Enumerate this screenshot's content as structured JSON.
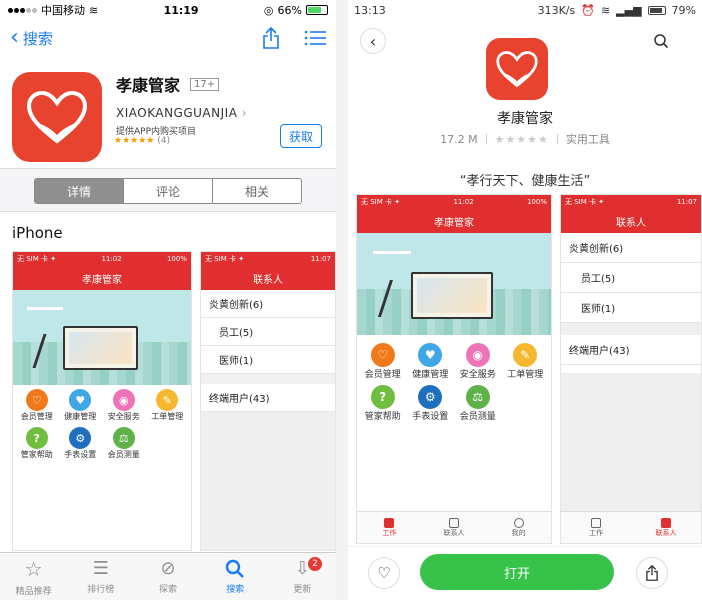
{
  "left": {
    "status": {
      "carrier": "中国移动",
      "time": "11:19",
      "battery": "66%"
    },
    "nav": {
      "back_label": "搜索"
    },
    "app": {
      "name": "孝康管家",
      "age": "17+",
      "developer": "XIAOKANGGUANJIA",
      "iap": "提供APP内购买项目",
      "stars": "★★★★★",
      "rating_count": "(4)",
      "get_label": "获取"
    },
    "segments": [
      {
        "label": "详情",
        "active": true
      },
      {
        "label": "评论",
        "active": false
      },
      {
        "label": "相关",
        "active": false
      }
    ],
    "section_title": "iPhone",
    "tabs": [
      {
        "label": "精品推荐",
        "icon": "star-icon"
      },
      {
        "label": "排行榜",
        "icon": "list-icon"
      },
      {
        "label": "探索",
        "icon": "compass-icon"
      },
      {
        "label": "搜索",
        "icon": "search-icon",
        "active": true
      },
      {
        "label": "更新",
        "icon": "download-icon",
        "badge": "2"
      }
    ]
  },
  "shot_home": {
    "status_left": "无 SIM 卡 ✦",
    "status_time": "11:02",
    "status_right": "100%",
    "title": "孝康管家",
    "features": [
      {
        "label": "会员管理",
        "color": "#f07a1b",
        "glyph": "♡"
      },
      {
        "label": "健康管理",
        "color": "#3fa7e6",
        "glyph": "♥"
      },
      {
        "label": "安全服务",
        "color": "#ee74b7",
        "glyph": "◉"
      },
      {
        "label": "工单管理",
        "color": "#f5b82e",
        "glyph": "✎"
      },
      {
        "label": "管家帮助",
        "color": "#6fbe3f",
        "glyph": "?"
      },
      {
        "label": "手表设置",
        "color": "#1f6fbf",
        "glyph": "⚙"
      },
      {
        "label": "会员测量",
        "color": "#5fb24a",
        "glyph": "⚖"
      }
    ],
    "tabs": [
      {
        "label": "工作",
        "active": true
      },
      {
        "label": "联系人",
        "active": false
      },
      {
        "label": "我的",
        "active": false
      }
    ]
  },
  "shot_contacts": {
    "status_left": "无 SIM 卡 ✦",
    "status_time": "11:07",
    "title": "联系人",
    "group": "炎黄创新(6)",
    "sub_items": [
      "员工(5)",
      "医师(1)"
    ],
    "terminal": "终端用户(43)",
    "tabs": [
      {
        "label": "工作",
        "active": false
      },
      {
        "label": "联系人",
        "active": true
      }
    ]
  },
  "right": {
    "status": {
      "time": "13:13",
      "speed": "313K/s",
      "battery": "79%"
    },
    "app": {
      "name": "孝康管家",
      "size": "17.2 M",
      "stars": "★★★★★",
      "category": "实用工具"
    },
    "slogan": "“孝行天下、健康生活”",
    "open_label": "打开"
  },
  "colors": {
    "ios_blue": "#1a7cf5",
    "app_red": "#e8432f",
    "header_red": "#e12e2e",
    "open_green": "#37c24a"
  }
}
